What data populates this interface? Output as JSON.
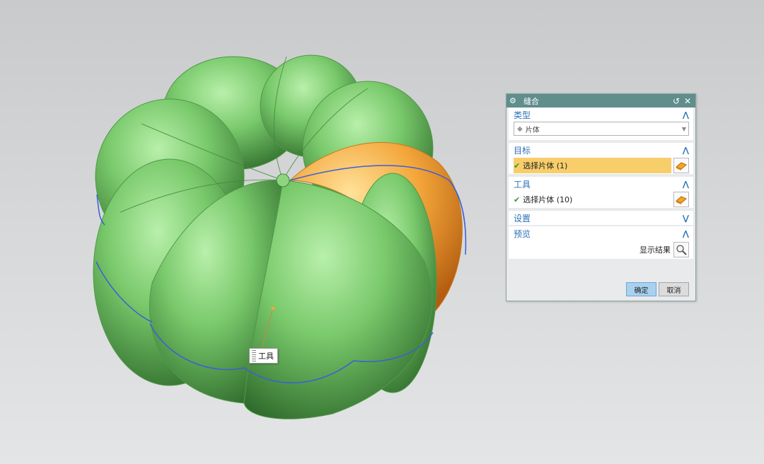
{
  "viewport": {
    "tooltip_label": "工具",
    "colors": {
      "body_green": "#6cbd5f",
      "target_orange": "#f3a63a",
      "edge_blue": "#3b5fd8"
    }
  },
  "dialog": {
    "title": "缝合",
    "icons": {
      "gear": "gear-icon",
      "reset": "reset-icon",
      "close": "close-icon"
    },
    "sections": {
      "type": {
        "label": "类型",
        "expanded": true,
        "combo_value": "片体"
      },
      "target": {
        "label": "目标",
        "expanded": true,
        "select_label": "选择片体 (1)"
      },
      "tool": {
        "label": "工具",
        "expanded": true,
        "select_label": "选择片体 (10)"
      },
      "settings": {
        "label": "设置",
        "expanded": false
      },
      "preview": {
        "label": "预览",
        "expanded": true,
        "show_result_label": "显示结果"
      }
    },
    "buttons": {
      "ok": "确定",
      "cancel": "取消"
    },
    "colors": {
      "titlebar": "#5f8e8b",
      "accent": "#2d72b8",
      "active_row": "#f7ce6a",
      "ok_button": "#a8d1ee"
    }
  }
}
